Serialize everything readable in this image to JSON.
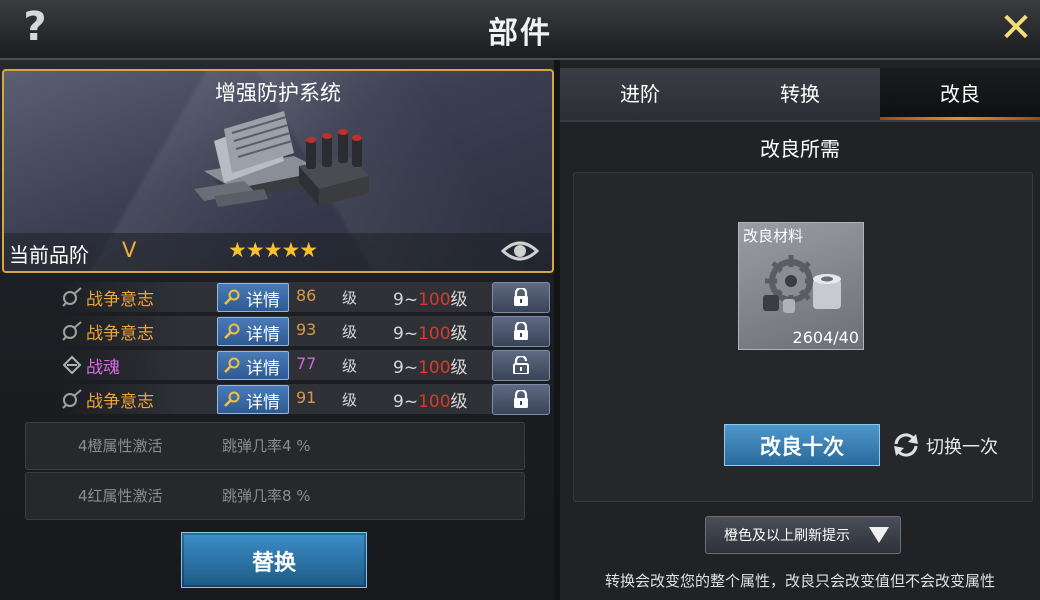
{
  "header": {
    "title": "部件",
    "help_icon": "?",
    "close_icon": "✕"
  },
  "item": {
    "name": "增强防护系统",
    "rarity_label": "当前品阶",
    "rarity_grade": "V",
    "stars": "★★★★★",
    "star_count": 5
  },
  "attributes": [
    {
      "name": "战争意志",
      "detail_label": "详情",
      "value": "86",
      "unit": "级",
      "range_min": "9~",
      "range_max": "100",
      "range_unit": "级",
      "locked": true
    },
    {
      "name": "战争意志",
      "detail_label": "详情",
      "value": "93",
      "unit": "级",
      "range_min": "9~",
      "range_max": "100",
      "range_unit": "级",
      "locked": true
    },
    {
      "name": "战魂",
      "detail_label": "详情",
      "value": "77",
      "unit": "级",
      "range_min": "9~",
      "range_max": "100",
      "range_unit": "级",
      "locked": false
    },
    {
      "name": "战争意志",
      "detail_label": "详情",
      "value": "91",
      "unit": "级",
      "range_min": "9~",
      "range_max": "100",
      "range_unit": "级",
      "locked": true
    }
  ],
  "activations": [
    {
      "condition": "4橙属性激活",
      "effect": "跳弹几率4 %"
    },
    {
      "condition": "4红属性激活",
      "effect": "跳弹几率8 %"
    }
  ],
  "replace_button": "替换",
  "tabs": [
    {
      "label": "进阶",
      "active": false
    },
    {
      "label": "转换",
      "active": false
    },
    {
      "label": "改良",
      "active": true
    }
  ],
  "improve": {
    "requirement_title": "改良所需",
    "material_name": "改良材料",
    "material_count": "2604/40",
    "improve_ten_button": "改良十次",
    "switch_once": "切换一次",
    "refresh_hint_dropdown": "橙色及以上刷新提示",
    "footnote": "转换会改变您的整个属性，改良只会改变值但不会改变属性"
  },
  "colors": {
    "accent_gold": "#d8a640",
    "orange_attr": "#f0a23a",
    "purple_attr": "#d86ae8",
    "max_red": "#d83a2a",
    "button_blue": "#2e6e9e"
  }
}
